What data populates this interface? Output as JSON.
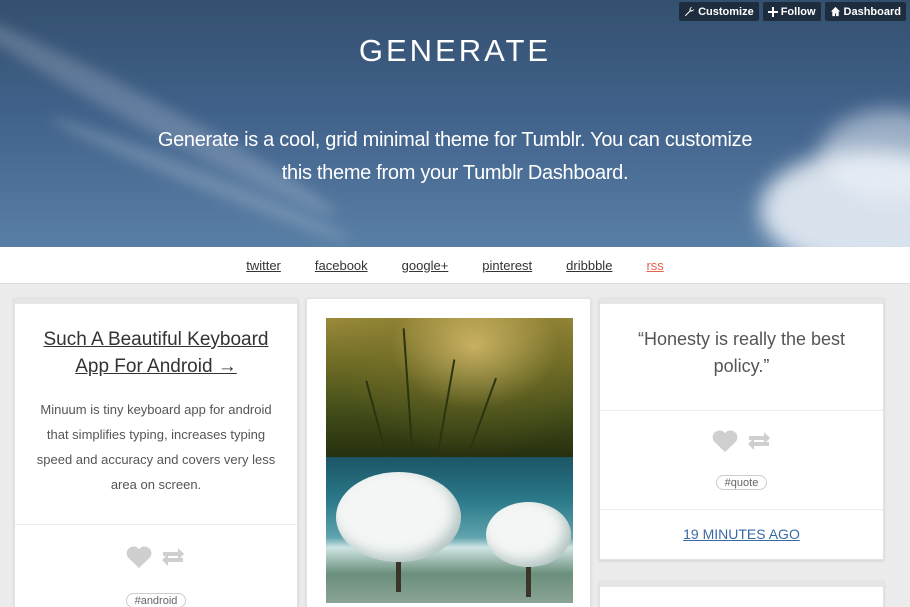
{
  "controls": {
    "customize": "Customize",
    "follow": "Follow",
    "dashboard": "Dashboard"
  },
  "header": {
    "title": "GENERATE",
    "description": "Generate is a cool, grid minimal theme for Tumblr. You can customize this theme from your Tumblr Dashboard."
  },
  "nav": {
    "items": [
      "twitter",
      "facebook",
      "google+",
      "pinterest",
      "dribbble",
      "rss"
    ]
  },
  "posts": {
    "text_post": {
      "title": "Such A Beautiful Keyboard App For Android →",
      "body": "Minuum is tiny keyboard app for android that simplifies typing, increases typing speed and accuracy and covers very less area on screen.",
      "tag": "#android"
    },
    "quote_post": {
      "quote": "“Honesty is really the best policy.”",
      "tag": "#quote",
      "time": "19 MINUTES AGO"
    }
  },
  "colors": {
    "accent_rss": "#e2644f",
    "link_blue": "#3b6aa3"
  }
}
